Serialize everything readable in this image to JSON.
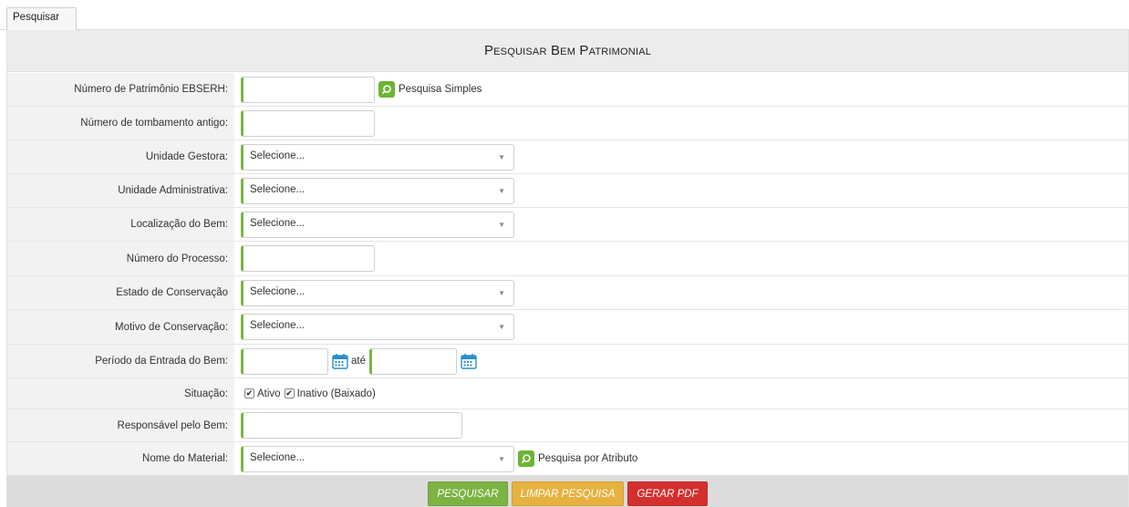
{
  "tab": {
    "label": "Pesquisar"
  },
  "title": "Pesquisar Bem Patrimonial",
  "fields": {
    "patrimonio": {
      "label": "Número de Patrimônio EBSERH:",
      "value": "",
      "link": "Pesquisa Simples"
    },
    "tombamento": {
      "label": "Número de tombamento antigo:",
      "value": ""
    },
    "unidade_gestora": {
      "label": "Unidade Gestora:",
      "selected": "Selecione..."
    },
    "unidade_administrativa": {
      "label": "Unidade Administrativa:",
      "selected": "Selecione..."
    },
    "localizacao": {
      "label": "Localização do Bem:",
      "selected": "Selecione..."
    },
    "processo": {
      "label": "Número do Processo:",
      "value": ""
    },
    "estado": {
      "label": "Estado de Conservação",
      "selected": "Selecione..."
    },
    "motivo": {
      "label": "Motivo de Conservação:",
      "selected": "Selecione..."
    },
    "periodo": {
      "label": "Período da Entrada do Bem:",
      "from": "",
      "to": "",
      "sep": "até"
    },
    "situacao": {
      "label": "Situação:",
      "ativo": "Ativo",
      "ativo_checked": true,
      "inativo": "Inativo (Baixado)",
      "inativo_checked": true
    },
    "responsavel": {
      "label": "Responsável pelo Bem:",
      "value": ""
    },
    "material": {
      "label": "Nome do Material:",
      "selected": "Selecione...",
      "link": "Pesquisa por Atributo"
    }
  },
  "buttons": {
    "pesquisar": "PESQUISAR",
    "limpar": "LIMPAR PESQUISA",
    "pdf": "GERAR PDF"
  },
  "colors": {
    "accent_green": "#7cb342",
    "orange": "#e7b13f",
    "red": "#d32f2f",
    "calendar_blue": "#2a8fc9"
  }
}
